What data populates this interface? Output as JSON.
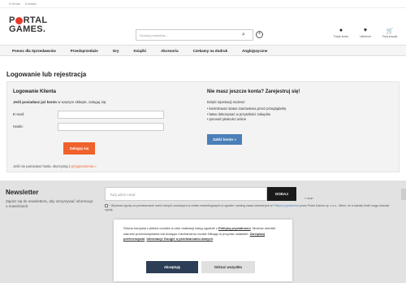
{
  "topbar": {
    "links": [
      "O firmie",
      "Kontakt"
    ]
  },
  "logo": {
    "line1": "PORTAL",
    "line2": "GAMES."
  },
  "search": {
    "placeholder": "Szukaj produktów..."
  },
  "user_links": [
    {
      "icon": "user-icon",
      "label": "Twoje konto"
    },
    {
      "icon": "heart-icon",
      "label": "Ulubione"
    },
    {
      "icon": "cart-icon",
      "label": "Twój koszyk"
    }
  ],
  "nav": [
    "Pomoc dla Sprzedawców",
    "Przedsprzedaże",
    "Gry",
    "Książki",
    "Akcesoria",
    "Czekamy na dodruk",
    "Anglojęzyczne"
  ],
  "page_title": "Logowanie lub rejestracja",
  "login": {
    "title": "Logowanie Klienta",
    "intro_bold": "Jeśli posiadasz już konto",
    "intro_rest": " w naszym sklepie, zaloguj się.",
    "email_label": "E-mail:",
    "password_label": "Hasło:",
    "submit": "Zaloguj się",
    "forgot_text": "Jeśli nie pamiętasz hasła, skorzystaj z ",
    "forgot_link": "przypomnienia »"
  },
  "register": {
    "title": "Nie masz jeszcze konta? Zarejestruj się!",
    "subtitle": "Dzięki rejestracji możesz:",
    "benefits": [
      "kontrolować status zamówienia przez przeglądarkę",
      "łatwo dokonywać w przyszłości zakupów",
      "ponowić płatności online"
    ],
    "button": "Załóż konto »"
  },
  "newsletter": {
    "title": "Newsletter",
    "desc": "Zapisz się do newslettera, aby otrzymywać informacje o nowościach.",
    "placeholder": "Twój adres email",
    "button": "DODAJ",
    "unsubscribe": "» usuń",
    "consent_a": "* Wyrażam zgodę na przetwarzanie moich danych osobowych w celach marketingowych w zgodzie i według zasad określonych w ",
    "consent_link": "Polityce prywatności",
    "consent_b": " przez Portal Games sp. z o.o.. Wiem, że w każdej chwili mogę odwołać zgodę."
  },
  "cookie": {
    "t1": "Strona korzysta z plików cookies w celu realizacji usług zgodnie z ",
    "link1": "Polityką prywatności",
    "t2": ". Możesz określić warunki przechowywania lub dostępu mechanizmu cookie Nikując w przycisk ustawień: ",
    "link2": "Zarządzaj preferencjami",
    "t3": ". ",
    "link3": "Informacje Google o przetwarzaniu danych",
    "t4": ".",
    "accept": "Akceptuję",
    "reject": "Odrzuć wszystko"
  }
}
